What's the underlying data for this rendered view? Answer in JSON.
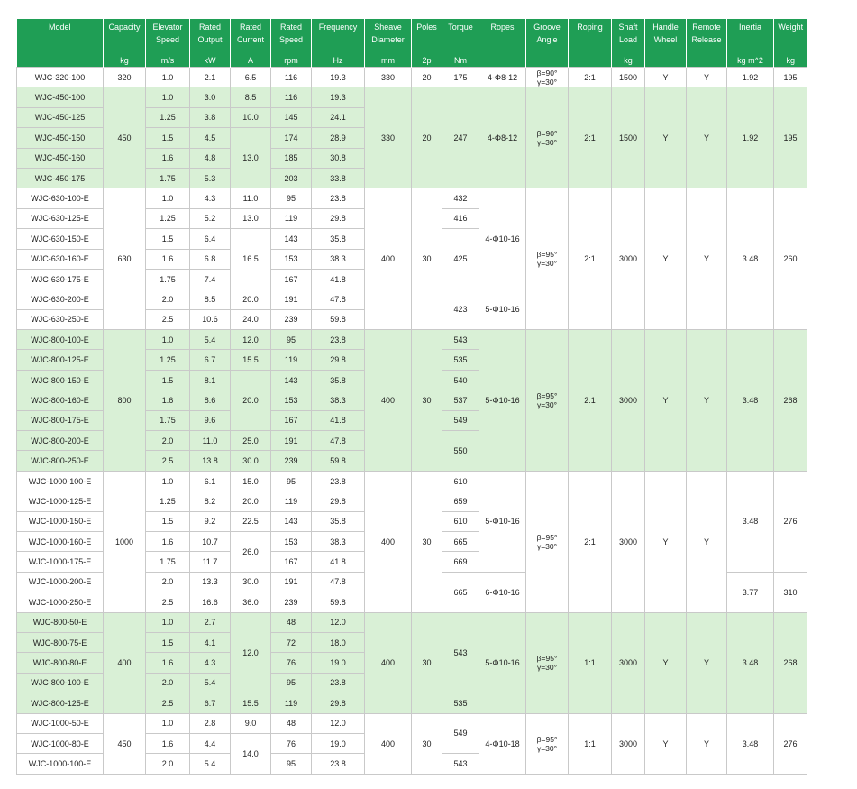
{
  "headers": [
    "Model",
    "Capacity",
    "Elevator Speed",
    "Rated Output",
    "Rated Current",
    "Rated Speed",
    "Frequency",
    "Sheave Diameter",
    "Poles",
    "Torque",
    "Ropes",
    "Groove Angle",
    "Roping",
    "Shaft Load",
    "Handle Wheel",
    "Remote Release",
    "Inertia",
    "Weight"
  ],
  "units": [
    "",
    "kg",
    "m/s",
    "kW",
    "A",
    "rpm",
    "Hz",
    "mm",
    "2p",
    "Nm",
    "",
    "",
    "",
    "kg",
    "",
    "",
    "kg m^2",
    "kg"
  ],
  "groove": {
    "b90": "β=90°",
    "b95": "β=95°",
    "g30": "γ=30°"
  },
  "rows": [
    [
      "WJC-320-100",
      "320",
      "1.0",
      "2.1",
      "6.5",
      "116",
      "19.3",
      "330",
      "20",
      "175",
      "4-Φ8-12",
      "",
      "2:1",
      "1500",
      "Y",
      "Y",
      "1.92",
      "195"
    ],
    [
      "WJC-450-100",
      "450",
      "1.0",
      "3.0",
      "8.5",
      "116",
      "19.3",
      "330",
      "20",
      "247",
      "4-Φ8-12",
      "",
      "2:1",
      "1500",
      "Y",
      "Y",
      "1.92",
      "195"
    ],
    [
      "WJC-450-125",
      "",
      "1.25",
      "3.8",
      "10.0",
      "145",
      "24.1"
    ],
    [
      "WJC-450-150",
      "",
      "1.5",
      "4.5",
      "13.0",
      "174",
      "28.9"
    ],
    [
      "WJC-450-160",
      "",
      "1.6",
      "4.8",
      "",
      "185",
      "30.8"
    ],
    [
      "WJC-450-175",
      "",
      "1.75",
      "5.3",
      "",
      "203",
      "33.8"
    ],
    [
      "WJC-630-100-E",
      "630",
      "1.0",
      "4.3",
      "11.0",
      "95",
      "23.8",
      "400",
      "30",
      "432",
      "4-Φ10-16",
      "",
      "2:1",
      "3000",
      "Y",
      "Y",
      "3.48",
      "260"
    ],
    [
      "WJC-630-125-E",
      "",
      "1.25",
      "5.2",
      "13.0",
      "119",
      "29.8",
      "",
      "",
      "416"
    ],
    [
      "WJC-630-150-E",
      "",
      "1.5",
      "6.4",
      "16.5",
      "143",
      "35.8",
      "",
      "",
      "425"
    ],
    [
      "WJC-630-160-E",
      "",
      "1.6",
      "6.8",
      "",
      "153",
      "38.3"
    ],
    [
      "WJC-630-175-E",
      "",
      "1.75",
      "7.4",
      "",
      "167",
      "41.8"
    ],
    [
      "WJC-630-200-E",
      "",
      "2.0",
      "8.5",
      "20.0",
      "191",
      "47.8",
      "",
      "",
      "423",
      "5-Φ10-16"
    ],
    [
      "WJC-630-250-E",
      "",
      "2.5",
      "10.6",
      "24.0",
      "239",
      "59.8"
    ],
    [
      "WJC-800-100-E",
      "800",
      "1.0",
      "5.4",
      "12.0",
      "95",
      "23.8",
      "400",
      "30",
      "543",
      "5-Φ10-16",
      "",
      "2:1",
      "3000",
      "Y",
      "Y",
      "3.48",
      "268"
    ],
    [
      "WJC-800-125-E",
      "",
      "1.25",
      "6.7",
      "15.5",
      "119",
      "29.8",
      "",
      "",
      "535"
    ],
    [
      "WJC-800-150-E",
      "",
      "1.5",
      "8.1",
      "20.0",
      "143",
      "35.8",
      "",
      "",
      "540"
    ],
    [
      "WJC-800-160-E",
      "",
      "1.6",
      "8.6",
      "",
      "153",
      "38.3",
      "",
      "",
      "537"
    ],
    [
      "WJC-800-175-E",
      "",
      "1.75",
      "9.6",
      "",
      "167",
      "41.8",
      "",
      "",
      "549"
    ],
    [
      "WJC-800-200-E",
      "",
      "2.0",
      "11.0",
      "25.0",
      "191",
      "47.8",
      "",
      "",
      "550"
    ],
    [
      "WJC-800-250-E",
      "",
      "2.5",
      "13.8",
      "30.0",
      "239",
      "59.8"
    ],
    [
      "WJC-1000-100-E",
      "1000",
      "1.0",
      "6.1",
      "15.0",
      "95",
      "23.8",
      "400",
      "30",
      "610",
      "5-Φ10-16",
      "",
      "2:1",
      "3000",
      "Y",
      "Y",
      "3.48",
      "276"
    ],
    [
      "WJC-1000-125-E",
      "",
      "1.25",
      "8.2",
      "20.0",
      "119",
      "29.8",
      "",
      "",
      "659"
    ],
    [
      "WJC-1000-150-E",
      "",
      "1.5",
      "9.2",
      "22.5",
      "143",
      "35.8",
      "",
      "",
      "610"
    ],
    [
      "WJC-1000-160-E",
      "",
      "1.6",
      "10.7",
      "26.0",
      "153",
      "38.3",
      "",
      "",
      "665"
    ],
    [
      "WJC-1000-175-E",
      "",
      "1.75",
      "11.7",
      "",
      "167",
      "41.8",
      "",
      "",
      "669"
    ],
    [
      "WJC-1000-200-E",
      "",
      "2.0",
      "13.3",
      "30.0",
      "191",
      "47.8",
      "",
      "",
      "665",
      "6-Φ10-16",
      "",
      "",
      "",
      "",
      "",
      "3.77",
      "310"
    ],
    [
      "WJC-1000-250-E",
      "",
      "2.5",
      "16.6",
      "36.0",
      "239",
      "59.8"
    ],
    [
      "WJC-800-50-E",
      "400",
      "1.0",
      "2.7",
      "12.0",
      "48",
      "12.0",
      "400",
      "30",
      "543",
      "5-Φ10-16",
      "",
      "1:1",
      "3000",
      "Y",
      "Y",
      "3.48",
      "268"
    ],
    [
      "WJC-800-75-E",
      "",
      "1.5",
      "4.1",
      "",
      "72",
      "18.0"
    ],
    [
      "WJC-800-80-E",
      "",
      "1.6",
      "4.3",
      "",
      "76",
      "19.0"
    ],
    [
      "WJC-800-100-E",
      "",
      "2.0",
      "5.4",
      "",
      "95",
      "23.8"
    ],
    [
      "WJC-800-125-E",
      "",
      "2.5",
      "6.7",
      "15.5",
      "119",
      "29.8",
      "",
      "",
      "535"
    ],
    [
      "WJC-1000-50-E",
      "450",
      "1.0",
      "2.8",
      "9.0",
      "48",
      "12.0",
      "400",
      "30",
      "549",
      "4-Φ10-18",
      "",
      "1:1",
      "3000",
      "Y",
      "Y",
      "3.48",
      "276"
    ],
    [
      "WJC-1000-80-E",
      "",
      "1.6",
      "4.4",
      "14.0",
      "76",
      "19.0"
    ],
    [
      "WJC-1000-100-E",
      "",
      "2.0",
      "5.4",
      "",
      "95",
      "23.8",
      "",
      "",
      "543"
    ]
  ]
}
